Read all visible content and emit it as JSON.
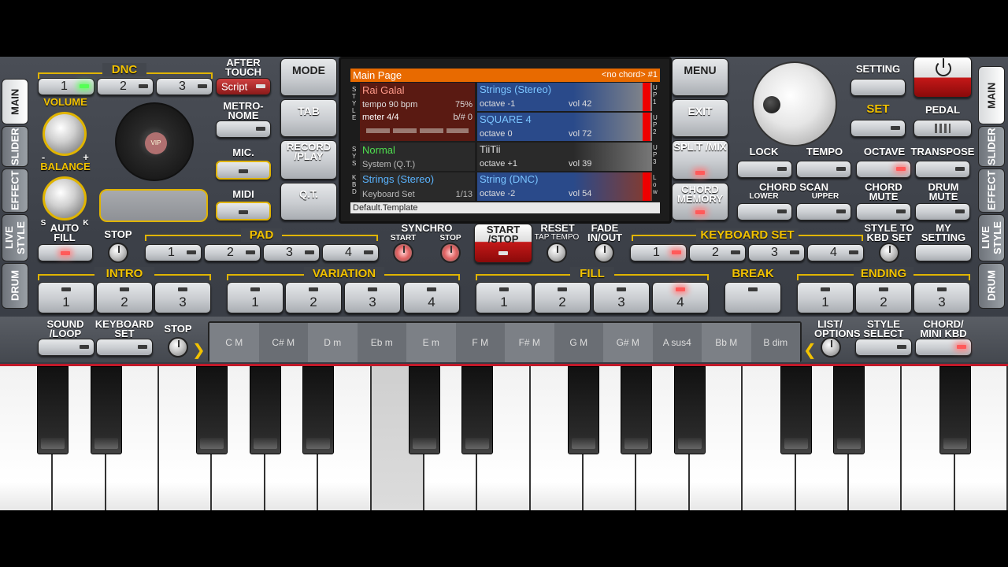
{
  "side": {
    "left": [
      "MAIN",
      "SLIDER",
      "EFFECT",
      "LIVE STYLE",
      "DRUM"
    ],
    "right": [
      "MAIN",
      "SLIDER",
      "EFFECT",
      "LIVE STYLE",
      "DRUM"
    ]
  },
  "dnc": {
    "title": "DNC",
    "buttons": [
      "1",
      "2",
      "3"
    ],
    "script": "Script"
  },
  "labels": {
    "after_touch": "AFTER TOUCH",
    "metronome": "METRO- NOME",
    "mic": "MIC.",
    "midi": "MIDI",
    "volume": "VOLUME",
    "balance": "BALANCE",
    "knob_s": "S",
    "knob_k": "K",
    "knob_minus": "-",
    "knob_plus": "+",
    "vip": "VIP",
    "auto_fill": "AUTO FILL",
    "stop": "STOP",
    "pad": "PAD",
    "synchro": "SYNCHRO",
    "synchro_start": "START",
    "synchro_stop": "STOP",
    "start_stop": "START /STOP",
    "reset": "RESET",
    "tap_tempo": "TAP TEMPO",
    "fade": "FADE IN/OUT",
    "keyboard_set": "KEYBOARD SET",
    "style_to_kbd": "STYLE TO KBD SET",
    "my_setting": "MY SETTING",
    "intro": "INTRO",
    "variation": "VARIATION",
    "fill": "FILL",
    "break": "BREAK",
    "ending": "ENDING",
    "sound_loop": "SOUND /LOOP",
    "keyboard_set_btn": "KEYBOARD SET",
    "stop2": "STOP",
    "list_options": "LIST/ OPTIONS",
    "style_select": "STYLE SELECT",
    "chord_mini": "CHORD/ MINI KBD"
  },
  "mid": {
    "mode": "MODE",
    "tab": "TAB",
    "record": "RECORD /PLAY",
    "qt": "Q.T."
  },
  "right": {
    "menu": "MENU",
    "exit": "EXIT",
    "split": "SPLIT /MIX",
    "chord_memory": "CHORD MEMORY",
    "setting": "SETTING",
    "set": "SET",
    "pedal": "PEDAL",
    "lock": "LOCK",
    "tempo": "TEMPO",
    "octave": "OCTAVE",
    "transpose": "TRANSPOSE",
    "chord_scan": "CHORD SCAN",
    "lower": "LOWER",
    "upper": "UPPER",
    "chord_mute": "CHORD MUTE",
    "drum_mute": "DRUM MUTE"
  },
  "screen": {
    "title": "Main Page",
    "chord_info": "<no chord> #1",
    "style_name": "Rai Galal",
    "tempo": "tempo 90 bpm",
    "percent": "75%",
    "meter": "meter 4/4",
    "bar": "b/# 0",
    "sys_name": "Normal",
    "sys_sub": "System (Q.T.)",
    "kbd_name": "Strings (Stereo)",
    "kbd_sub": "Keyboard Set",
    "kbd_count": "1/13",
    "side_style": "STYLE",
    "side_sys": "SYS",
    "side_kbd": "KBD",
    "parts": [
      {
        "name": "Strings (Stereo)",
        "octave": "octave -1",
        "vol": "vol 42",
        "tag": "UP1"
      },
      {
        "name": "SQUARE 4",
        "octave": "octave  0",
        "vol": "vol 72",
        "tag": "UP2"
      },
      {
        "name": "TiiTii",
        "octave": "octave +1",
        "vol": "vol 39",
        "tag": "UP3"
      },
      {
        "name": "String (DNC)",
        "octave": "octave -2",
        "vol": "vol 54",
        "tag": "Low"
      }
    ],
    "footer": "Default.Template"
  },
  "pads": [
    "1",
    "2",
    "3",
    "4"
  ],
  "keyboard_set": [
    "1",
    "2",
    "3",
    "4"
  ],
  "intro": [
    "1",
    "2",
    "3"
  ],
  "variation": [
    "1",
    "2",
    "3",
    "4"
  ],
  "fill": [
    "1",
    "2",
    "3",
    "4"
  ],
  "ending": [
    "1",
    "2",
    "3"
  ],
  "chords": [
    "C M",
    "C# M",
    "D m",
    "Eb m",
    "E m",
    "F M",
    "F# M",
    "G M",
    "G# M",
    "A sus4",
    "Bb M",
    "B dim"
  ],
  "colors": {
    "accent": "#f2c200",
    "screen_header": "#e86a00",
    "led_red": "#ff5a5a"
  }
}
